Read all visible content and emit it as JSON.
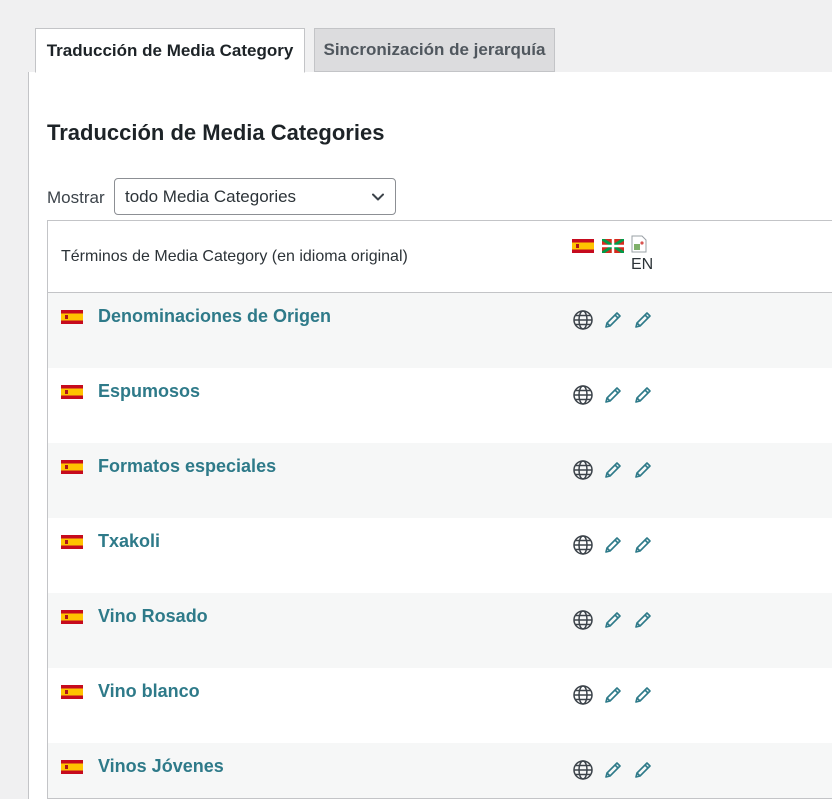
{
  "tabs": [
    {
      "label": "Traducción de Media Category",
      "active": true
    },
    {
      "label": "Sincronización de jerarquía",
      "active": false
    }
  ],
  "page_title": "Traducción de Media Categories",
  "filter": {
    "label": "Mostrar",
    "selected": "todo Media Categories"
  },
  "table": {
    "header_label": "Términos de Media Category (en idioma original)",
    "languages": [
      {
        "code": "es",
        "icon": "spain-flag-icon"
      },
      {
        "code": "eu",
        "icon": "basque-flag-icon"
      },
      {
        "code": "en",
        "icon": "broken-image-icon",
        "alt": "EN"
      }
    ],
    "rows": [
      {
        "name": "Denominaciones de Origen"
      },
      {
        "name": "Espumosos"
      },
      {
        "name": "Formatos especiales"
      },
      {
        "name": "Txakoli"
      },
      {
        "name": "Vino Rosado"
      },
      {
        "name": "Vino blanco"
      },
      {
        "name": "Vinos Jóvenes"
      }
    ],
    "row_actions": [
      "globe-icon",
      "pencil-icon",
      "pencil-icon"
    ]
  },
  "colors": {
    "link": "#2e7a89",
    "border": "#c3c4c7",
    "row_alt": "#f6f7f7",
    "background": "#f0f0f1"
  }
}
